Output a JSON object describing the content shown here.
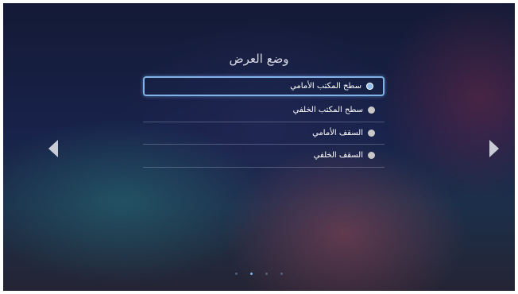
{
  "title": "وضع العرض",
  "options": [
    {
      "label": "سطح المكتب الأمامي",
      "selected": true
    },
    {
      "label": "سطح المكتب الخلفي",
      "selected": false
    },
    {
      "label": "السقف الأمامي",
      "selected": false
    },
    {
      "label": "السقف الخلفي",
      "selected": false
    }
  ],
  "navigation": {
    "left_icon": "left-arrow-icon",
    "right_icon": "right-arrow-icon"
  },
  "page_indicator": {
    "total": 4,
    "current": 2
  },
  "colors": {
    "accent": "#7fb2e6",
    "text": "#ffffff",
    "radio_unselected": "#c8c8c8"
  }
}
